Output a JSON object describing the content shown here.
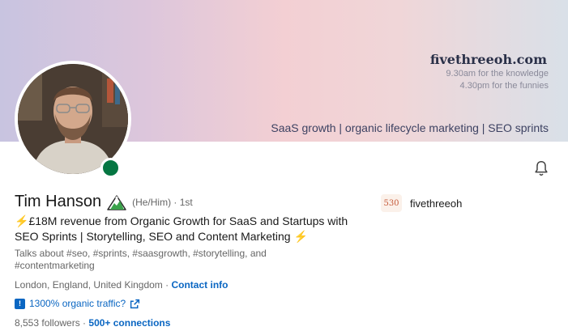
{
  "banner": {
    "brand": "fivethreeoh.com",
    "line1": "9.30am for the knowledge",
    "line2": "4.30pm for the funnies",
    "tagline": "SaaS growth | organic lifecycle marketing | SEO sprints"
  },
  "profile": {
    "name": "Tim Hanson",
    "pronouns": "(He/Him) · 1st",
    "headline_line1": "£18M revenue from Organic Growth for SaaS and Startups with",
    "headline_line2": "SEO Sprints | Storytelling, SEO and Content Marketing",
    "talks_about": "Talks about #seo, #sprints, #saasgrowth, #storytelling, and #contentmarketing",
    "location": "London, England, United Kingdom",
    "separator": " · ",
    "contact_info": "Contact info",
    "website_label": "1300% organic traffic?",
    "followers": "8,553 followers",
    "connections": "500+ connections"
  },
  "company": {
    "logo_text": "530",
    "name": "fivethreeoh"
  },
  "icons": {
    "bell": "bell-icon",
    "badge": "mountain-badge-icon",
    "bolt": "lightning-bolt-icon",
    "info": "info-square-icon",
    "external": "external-link-icon"
  },
  "colors": {
    "link": "#0a66c2",
    "online": "#057642",
    "bolt": "#f0b400"
  }
}
